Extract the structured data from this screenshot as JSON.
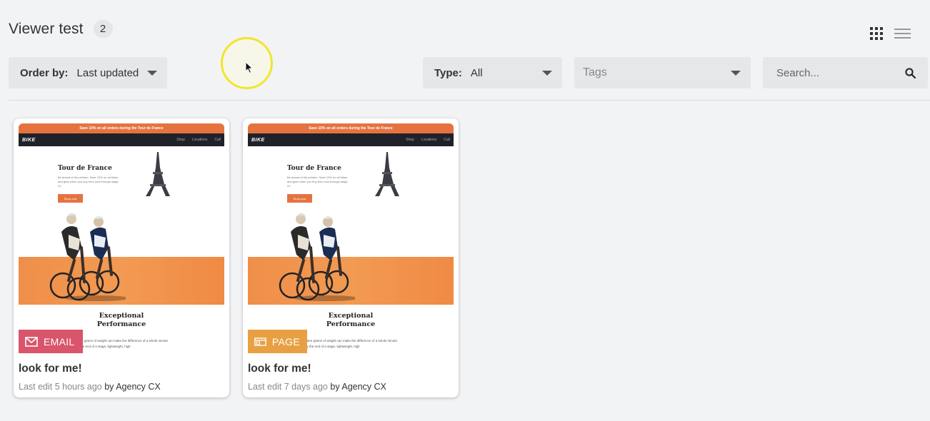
{
  "header": {
    "title": "Viewer test",
    "count": "2"
  },
  "view_toggles": {
    "grid": "grid-view-icon",
    "list": "list-view-icon"
  },
  "filters": {
    "order": {
      "label": "Order by:",
      "value": "Last updated"
    },
    "type": {
      "label": "Type:",
      "value": "All"
    },
    "tags": {
      "placeholder": "Tags"
    },
    "search": {
      "placeholder": "Search..."
    }
  },
  "thumbnail": {
    "promo": "Save 10% on all orders during the Tour de France",
    "brand": "BIKE",
    "nav": [
      "Shop",
      "Locations",
      "Call"
    ],
    "hero_title": "Tour de France",
    "hero_text": "Be ahead of the peloton. Save 10% on all bikes and gear when you buy from now through stage 21.",
    "hero_button": "Shop now",
    "section_title_line1": "Exceptional",
    "section_title_line2": "Performance",
    "section_text": "Mere grams of weight can make the difference of a whole minute by the end of a stage, lightweight, high"
  },
  "cards": [
    {
      "type_label": "EMAIL",
      "type_icon": "mail-icon",
      "type_color": "#d9556b",
      "title": "look for me!",
      "edited": "Last edit 5 hours ago",
      "by": "by Agency CX"
    },
    {
      "type_label": "PAGE",
      "type_icon": "page-icon",
      "type_color": "#e8a044",
      "title": "look for me!",
      "edited": "Last edit 7 days ago",
      "by": "by Agency CX"
    }
  ],
  "colors": {
    "accent_orange": "#e57340",
    "background": "#f2f3f5",
    "cursor_highlight": "#f2e52a"
  }
}
